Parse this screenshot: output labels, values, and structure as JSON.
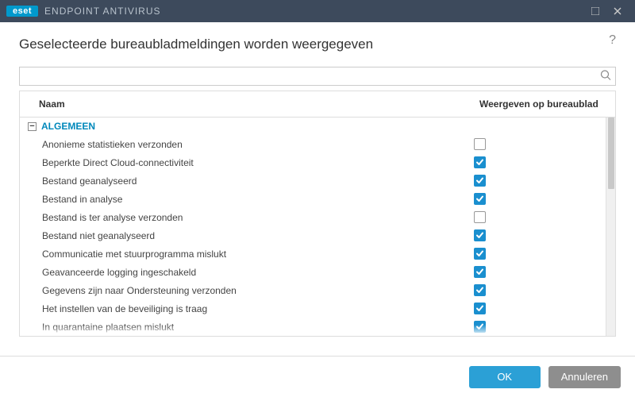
{
  "titlebar": {
    "brand": "eset",
    "product": "ENDPOINT ANTIVIRUS"
  },
  "page": {
    "title": "Geselecteerde bureaubladmeldingen worden weergegeven"
  },
  "search": {
    "placeholder": ""
  },
  "table": {
    "columns": {
      "name": "Naam",
      "show": "Weergeven op bureaublad"
    },
    "groups": [
      {
        "label": "ALGEMEEN",
        "expanded": true,
        "rows": [
          {
            "name": "Anonieme statistieken verzonden",
            "checked": false
          },
          {
            "name": "Beperkte Direct Cloud-connectiviteit",
            "checked": true
          },
          {
            "name": "Bestand geanalyseerd",
            "checked": true
          },
          {
            "name": "Bestand in analyse",
            "checked": true
          },
          {
            "name": "Bestand is ter analyse verzonden",
            "checked": false
          },
          {
            "name": "Bestand niet geanalyseerd",
            "checked": true
          },
          {
            "name": "Communicatie met stuurprogramma mislukt",
            "checked": true
          },
          {
            "name": "Geavanceerde logging ingeschakeld",
            "checked": true
          },
          {
            "name": "Gegevens zijn naar Ondersteuning verzonden",
            "checked": true
          },
          {
            "name": "Het instellen van de beveiliging is traag",
            "checked": true
          },
          {
            "name": "In quarantaine plaatsen mislukt",
            "checked": true
          }
        ]
      }
    ]
  },
  "footer": {
    "ok": "OK",
    "cancel": "Annuleren"
  }
}
